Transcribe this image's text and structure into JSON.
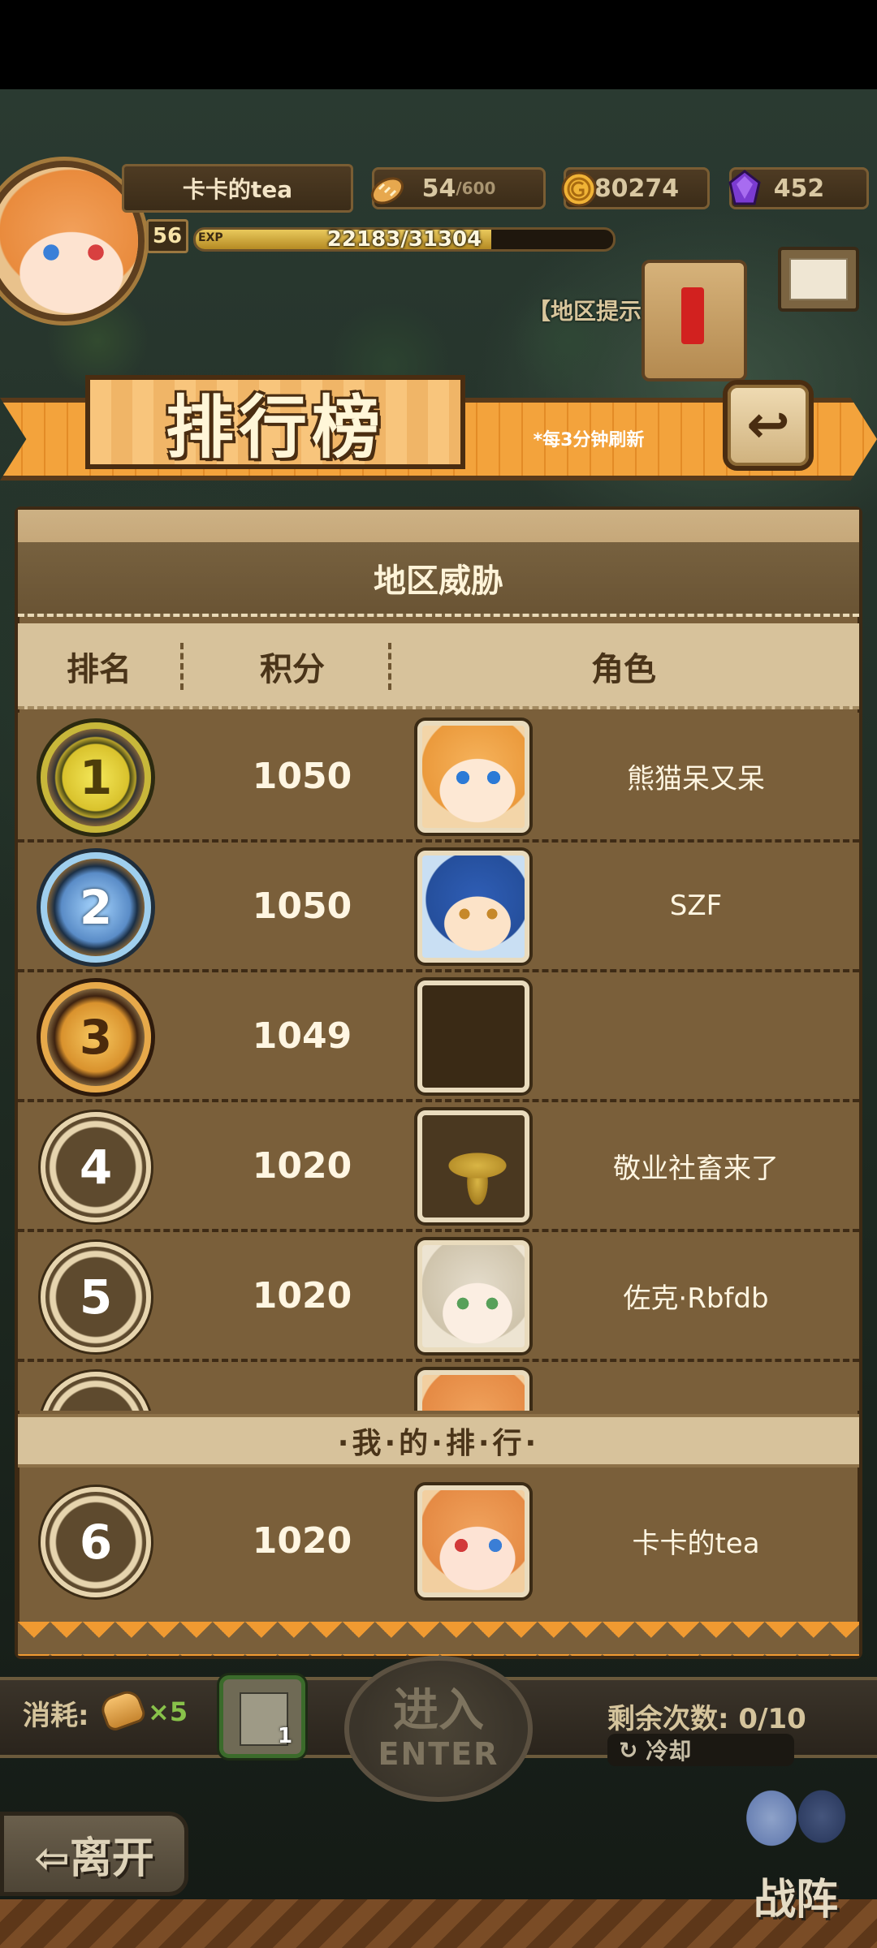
{
  "hud": {
    "player_name": "卡卡的tea",
    "level": "56",
    "exp_tag": "EXP",
    "exp_text": "22183/31304",
    "exp_fraction": 0.709,
    "stamina_current": "54",
    "stamina_max": "/600",
    "gold": "80274",
    "gems": "452",
    "region_hint": "【地区提示"
  },
  "banner": {
    "title": "排行榜",
    "refresh_note": "*每3分钟刷新",
    "back_icon": "↩"
  },
  "panel": {
    "title": "地区威胁",
    "columns": [
      "排名",
      "积分",
      "角色"
    ]
  },
  "rankings": [
    {
      "rank": "1",
      "score": "1050",
      "name": "熊猫呆又呆",
      "portrait": "orange-hair-girl"
    },
    {
      "rank": "2",
      "score": "1050",
      "name": "SZF",
      "portrait": "blue-cat-boy"
    },
    {
      "rank": "3",
      "score": "1049",
      "name": "",
      "portrait": "empty"
    },
    {
      "rank": "4",
      "score": "1020",
      "name": "敬业社畜来了",
      "portrait": "gold-eagle-emblem"
    },
    {
      "rank": "5",
      "score": "1020",
      "name": "佐克·Rbfdb",
      "portrait": "silver-hair-girl"
    }
  ],
  "my_rank": {
    "label": "·我·的·排·行·",
    "rank": "6",
    "score": "1020",
    "name": "卡卡的tea",
    "portrait": "orange-hair-girl-hat"
  },
  "bottom": {
    "cost_label": "消耗:",
    "cost_count": "×5",
    "map_count": "1",
    "enter_cn": "进入",
    "enter_en": "ENTER",
    "remain": "剩余次数: 0/10",
    "cooldown": "冷却",
    "leave": "⇦离开",
    "lineup": "战阵"
  }
}
